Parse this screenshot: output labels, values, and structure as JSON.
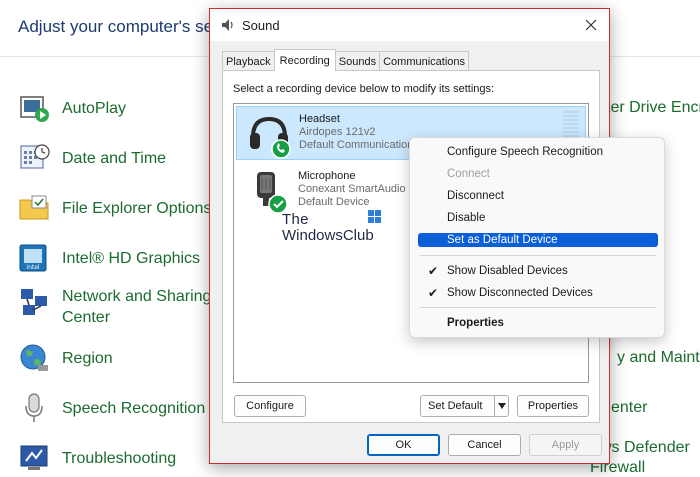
{
  "control_panel": {
    "header": "Adjust your computer's sett",
    "items": [
      {
        "label": "AutoPlay",
        "icon": "autoplay-icon"
      },
      {
        "label": "Date and Time",
        "icon": "date-time-icon"
      },
      {
        "label": "File Explorer Options",
        "icon": "folder-options-icon"
      },
      {
        "label": "Intel® HD Graphics",
        "icon": "intel-graphics-icon"
      },
      {
        "label": "Network and Sharing",
        "label2": "Center",
        "icon": "network-icon"
      },
      {
        "label": "Region",
        "icon": "region-globe-icon"
      },
      {
        "label": "Speech Recognition",
        "icon": "microphone-icon"
      },
      {
        "label": "Troubleshooting",
        "icon": "troubleshooting-icon"
      }
    ],
    "right_items": {
      "drive_encryption": "ter Drive Encry",
      "security_maintenance": "y and Mainte",
      "center": "enter",
      "defender_line1": "ws Defender",
      "defender_line2": "Firewall"
    }
  },
  "dialog": {
    "title": "Sound",
    "tabs": [
      "Playback",
      "Recording",
      "Sounds",
      "Communications"
    ],
    "active_tab": "Recording",
    "instruction": "Select a recording device below to modify its settings:",
    "devices": [
      {
        "name": "Headset",
        "model": "Airdopes 121v2",
        "status": "Default Communications Device",
        "selected": true
      },
      {
        "name": "Microphone",
        "model": "Conexant SmartAudio HD",
        "status": "Default Device",
        "selected": false
      }
    ],
    "watermark": {
      "line1": "The",
      "line2": "WindowsClub"
    },
    "buttons": {
      "configure": "Configure",
      "set_default": "Set Default",
      "properties": "Properties",
      "ok": "OK",
      "cancel": "Cancel",
      "apply": "Apply"
    }
  },
  "context_menu": {
    "items": {
      "configure_speech": "Configure Speech Recognition",
      "connect": "Connect",
      "disconnect": "Disconnect",
      "disable": "Disable",
      "set_default": "Set as Default Device",
      "show_disabled": "Show Disabled Devices",
      "show_disconnected": "Show Disconnected Devices",
      "properties": "Properties"
    }
  },
  "colors": {
    "link_green": "#1c6b2f",
    "header_blue": "#1e3a6e",
    "dialog_border": "#d22a32",
    "selection": "#cce8ff",
    "menu_highlight": "#0a5ed7",
    "default_check": "#15a046"
  }
}
